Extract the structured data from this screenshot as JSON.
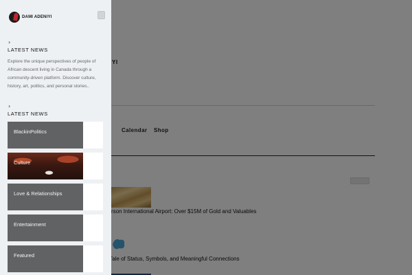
{
  "background": {
    "logo_fragment": "YI",
    "nav": [
      "Calendar",
      "Shop"
    ],
    "articles": [
      "rson International Airport: Over $15M of Gold and Valuables",
      "er Tale of Status, Symbols, and Meaningful Connections"
    ]
  },
  "drawer": {
    "logo_text": "DAMI ADENIYI",
    "section1_title": "LATEST NEWS",
    "description": "Explore the unique perspectives of people of African descent living in Canada through a community-driven platform. Discover culture, history, art, politics, and personal stories..",
    "section2_title": "LATEST NEWS",
    "categories": [
      {
        "label": "BlackinPolitics"
      },
      {
        "label": "Culture"
      },
      {
        "label": "Love & Relationships"
      },
      {
        "label": "Entertainment"
      },
      {
        "label": "Featured"
      }
    ]
  },
  "colors": {
    "drawer_bg": "#eef1f4",
    "category_tile": "#616263",
    "overlay": "rgba(0,0,0,0.5)"
  },
  "icons": [
    "chevron-right-icon",
    "close-icon",
    "logo-icon"
  ]
}
